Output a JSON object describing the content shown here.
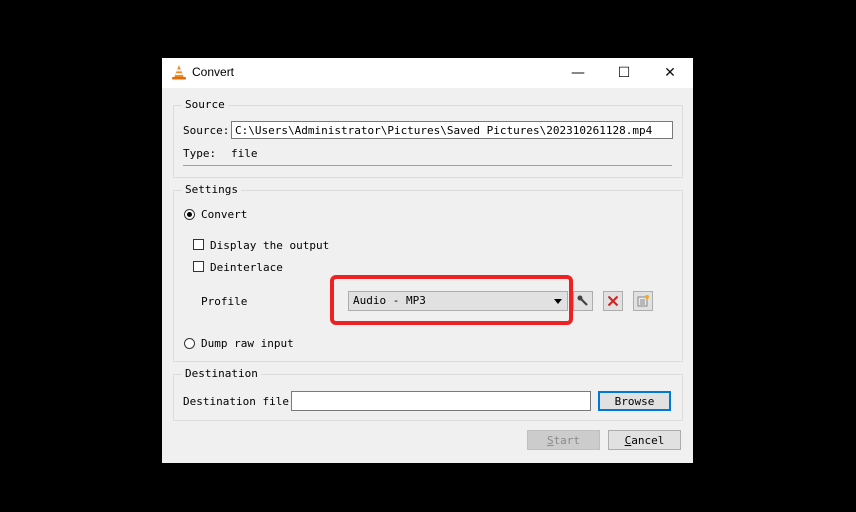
{
  "window": {
    "title": "Convert",
    "controls": {
      "minimize": "—",
      "maximize": "☐",
      "close": "✕"
    }
  },
  "source": {
    "group_label": "Source",
    "source_label": "Source:",
    "source_value": "C:\\Users\\Administrator\\Pictures\\Saved Pictures\\202310261128.mp4",
    "type_label": "Type:",
    "type_value": "file"
  },
  "settings": {
    "group_label": "Settings",
    "convert_label": "Convert",
    "convert_selected": true,
    "display_output_label": "Display the output",
    "display_output_checked": false,
    "deinterlace_label": "Deinterlace",
    "deinterlace_checked": false,
    "profile_label": "Profile",
    "profile_value": "Audio - MP3",
    "dump_raw_label": "Dump raw input",
    "dump_raw_selected": false,
    "highlight_color": "#ee2222"
  },
  "destination": {
    "group_label": "Destination",
    "file_label": "Destination file:",
    "file_value": "",
    "browse_label": "Browse"
  },
  "footer": {
    "start_label": "Start",
    "start_mnemonic": "S",
    "start_rest": "tart",
    "cancel_mnemonic": "C",
    "cancel_rest": "ancel"
  }
}
